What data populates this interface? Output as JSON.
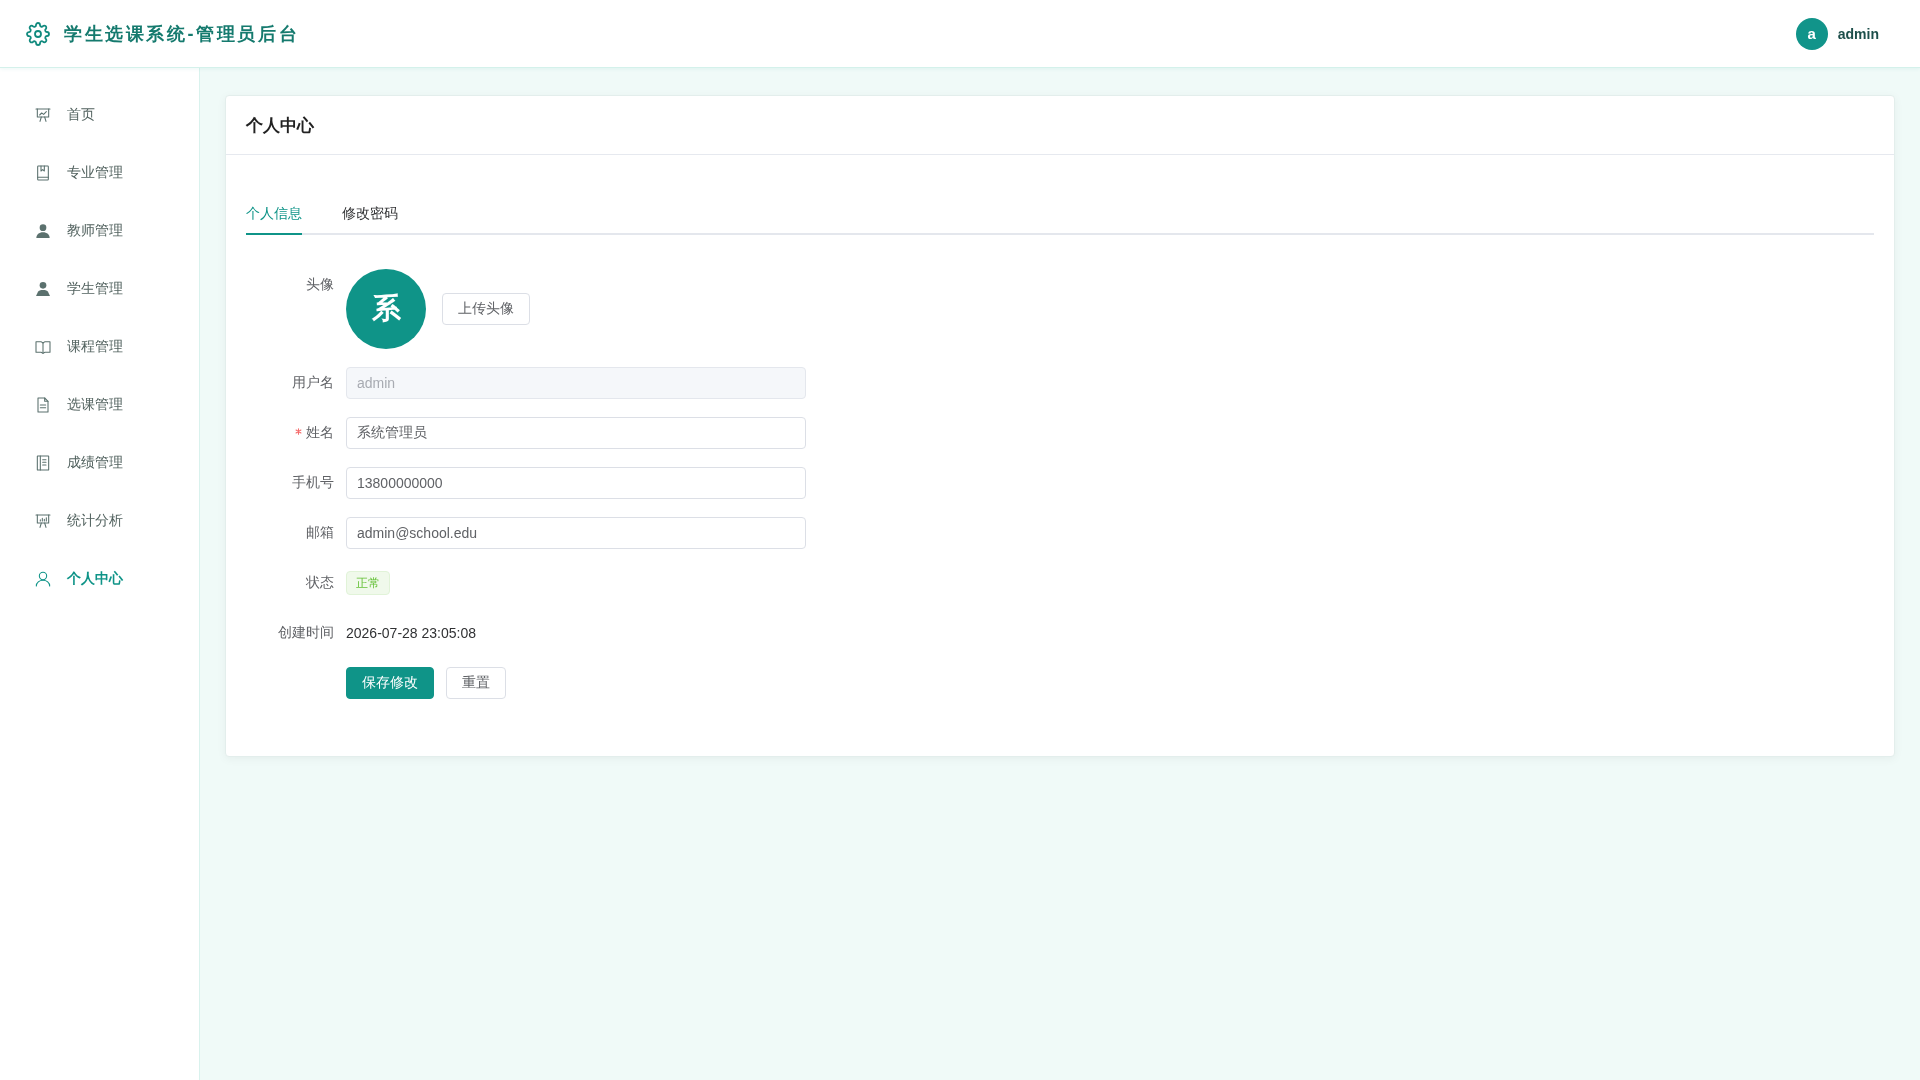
{
  "header": {
    "title": "学生选课系统-管理员后台",
    "user": {
      "avatar_letter": "a",
      "name": "admin"
    }
  },
  "sidebar": {
    "items": [
      {
        "label": "首页",
        "selected": false
      },
      {
        "label": "专业管理",
        "selected": false
      },
      {
        "label": "教师管理",
        "selected": false
      },
      {
        "label": "学生管理",
        "selected": false
      },
      {
        "label": "课程管理",
        "selected": false
      },
      {
        "label": "选课管理",
        "selected": false
      },
      {
        "label": "成绩管理",
        "selected": false
      },
      {
        "label": "统计分析",
        "selected": false
      },
      {
        "label": "个人中心",
        "selected": true
      }
    ]
  },
  "card": {
    "title": "个人中心"
  },
  "tabs": [
    {
      "label": "个人信息",
      "selected": true
    },
    {
      "label": "修改密码",
      "selected": false
    }
  ],
  "form": {
    "avatar": {
      "label": "头像",
      "letter": "系",
      "button": "上传头像"
    },
    "fields": [
      {
        "label": "用户名",
        "value": "admin",
        "disabled": true,
        "required": false
      },
      {
        "label": "姓名",
        "value": "系统管理员",
        "disabled": false,
        "required": true
      },
      {
        "label": "手机号",
        "value": "13800000000",
        "disabled": false,
        "required": false
      },
      {
        "label": "邮箱",
        "value": "admin@school.edu",
        "disabled": false,
        "required": false
      }
    ],
    "status": {
      "label": "状态",
      "value": "正常"
    },
    "created": {
      "label": "创建时间",
      "value": "2026-07-28 23:05:08"
    },
    "buttons": [
      {
        "label": "保存修改",
        "kind": "primary"
      },
      {
        "label": "重置",
        "kind": "default"
      }
    ]
  }
}
